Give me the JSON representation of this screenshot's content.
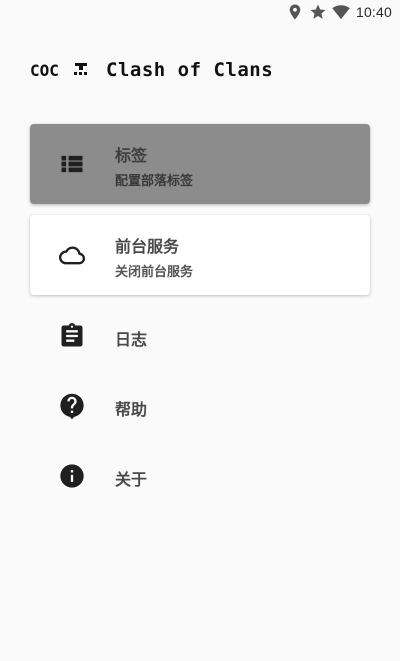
{
  "status_bar": {
    "time": "10:40",
    "icons": [
      "location-icon",
      "star-icon",
      "wifi-icon"
    ]
  },
  "header": {
    "logo_text": "COC",
    "title": "Clash of Clans"
  },
  "menu": {
    "items": [
      {
        "icon": "list-icon",
        "title": "标签",
        "subtitle": "配置部落标签",
        "state": "selected"
      },
      {
        "icon": "cloud-icon",
        "title": "前台服务",
        "subtitle": "关闭前台服务",
        "state": "card"
      },
      {
        "icon": "clipboard-icon",
        "title": "日志"
      },
      {
        "icon": "help-icon",
        "title": "帮助"
      },
      {
        "icon": "info-icon",
        "title": "关于"
      }
    ]
  },
  "colors": {
    "background": "#fafafa",
    "selected_item": "#8c8c8c",
    "card": "#ffffff",
    "icon": "#212121"
  }
}
